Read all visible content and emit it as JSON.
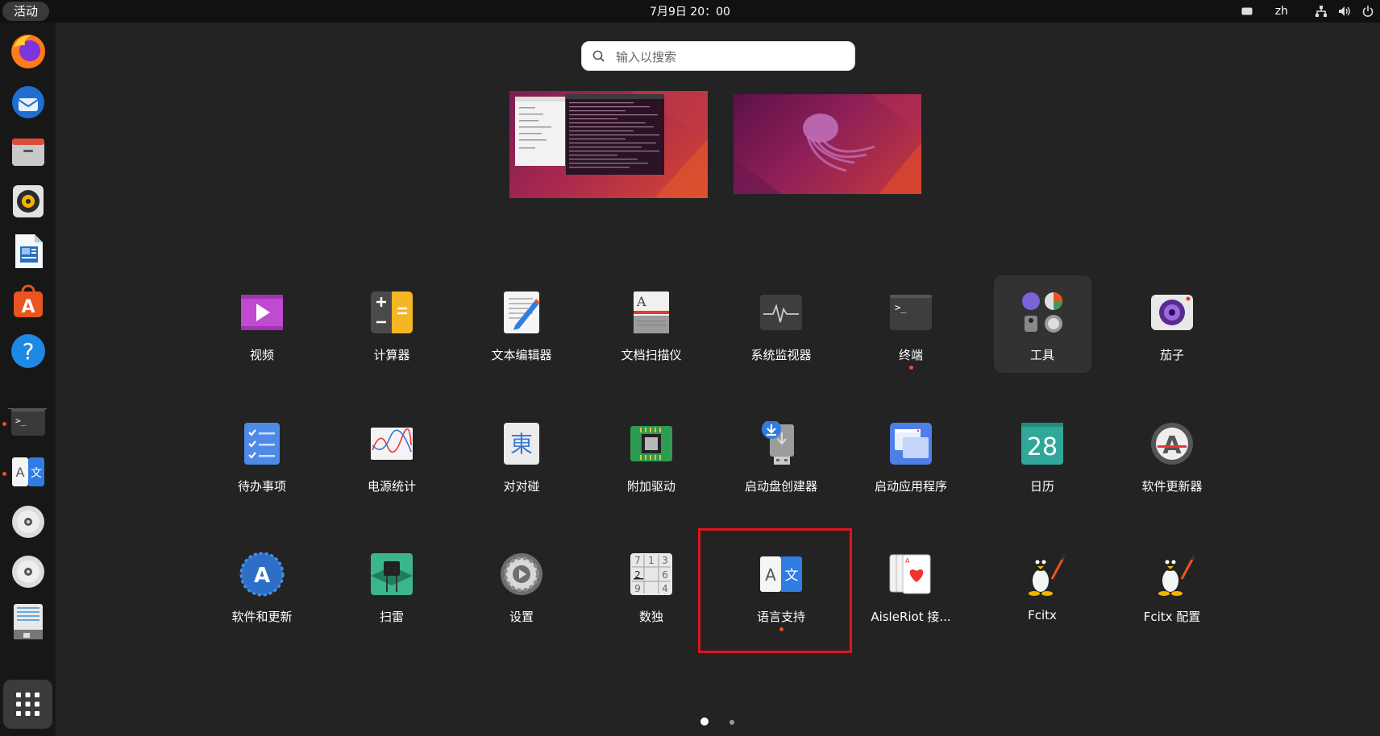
{
  "topbar": {
    "activities": "活动",
    "clock": "7月9日  20：00",
    "language": "zh"
  },
  "search": {
    "placeholder": "输入以搜索"
  },
  "apps": [
    {
      "label": "视频"
    },
    {
      "label": "计算器"
    },
    {
      "label": "文本编辑器"
    },
    {
      "label": "文档扫描仪"
    },
    {
      "label": "系统监视器"
    },
    {
      "label": "终端"
    },
    {
      "label": "工具"
    },
    {
      "label": "茄子"
    },
    {
      "label": "待办事项"
    },
    {
      "label": "电源统计"
    },
    {
      "label": "对对碰"
    },
    {
      "label": "附加驱动"
    },
    {
      "label": "启动盘创建器"
    },
    {
      "label": "启动应用程序"
    },
    {
      "label": "日历"
    },
    {
      "label": "软件更新器"
    },
    {
      "label": "软件和更新"
    },
    {
      "label": "扫雷"
    },
    {
      "label": "设置"
    },
    {
      "label": "数独"
    },
    {
      "label": "语言支持"
    },
    {
      "label": "AisleRiot 接..."
    },
    {
      "label": "Fcitx"
    },
    {
      "label": "Fcitx 配置"
    }
  ],
  "icons": {
    "calendar_day": "28",
    "kanji": "東",
    "lang_a": "A",
    "lang_wen": "文",
    "sudoku": [
      "7",
      "1",
      "3",
      "2",
      "6",
      "9",
      "4"
    ]
  },
  "colors": {
    "accent": "#e95420",
    "highlight": "#e0141e"
  }
}
